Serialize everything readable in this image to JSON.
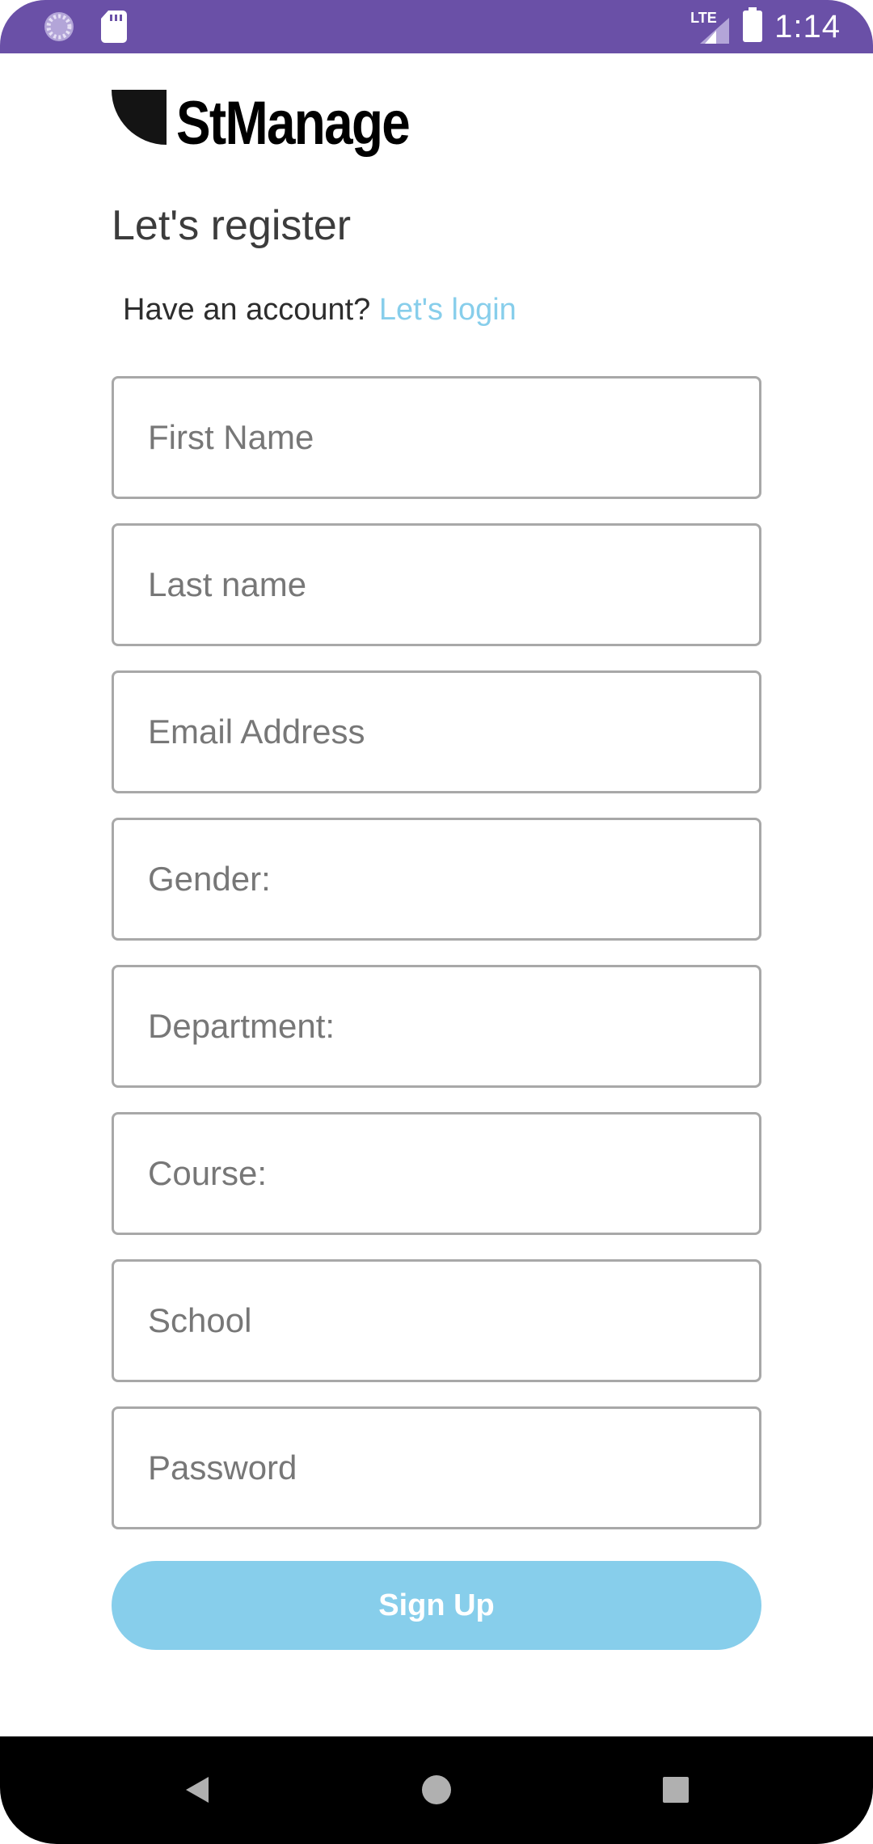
{
  "status_bar": {
    "network": "LTE",
    "time": "1:14",
    "icons": [
      "loading-icon",
      "sd-card-icon",
      "signal-icon",
      "battery-icon"
    ],
    "color": "#6a50a7"
  },
  "app": {
    "name": "StManage"
  },
  "register": {
    "heading": "Let's register",
    "have_account_text": "Have an account?",
    "login_link": "Let's login"
  },
  "form": {
    "first_name_placeholder": "First Name",
    "last_name_placeholder": "Last name",
    "email_placeholder": "Email Address",
    "gender_placeholder": "Gender:",
    "department_placeholder": "Department:",
    "course_placeholder": "Course:",
    "school_placeholder": "School",
    "password_placeholder": "Password",
    "signup_label": "Sign Up"
  },
  "colors": {
    "accent": "#87ceeb",
    "field_border": "#a8a8a8"
  },
  "nav_bar": {
    "icons": [
      "back-icon",
      "home-icon",
      "recents-icon"
    ]
  }
}
